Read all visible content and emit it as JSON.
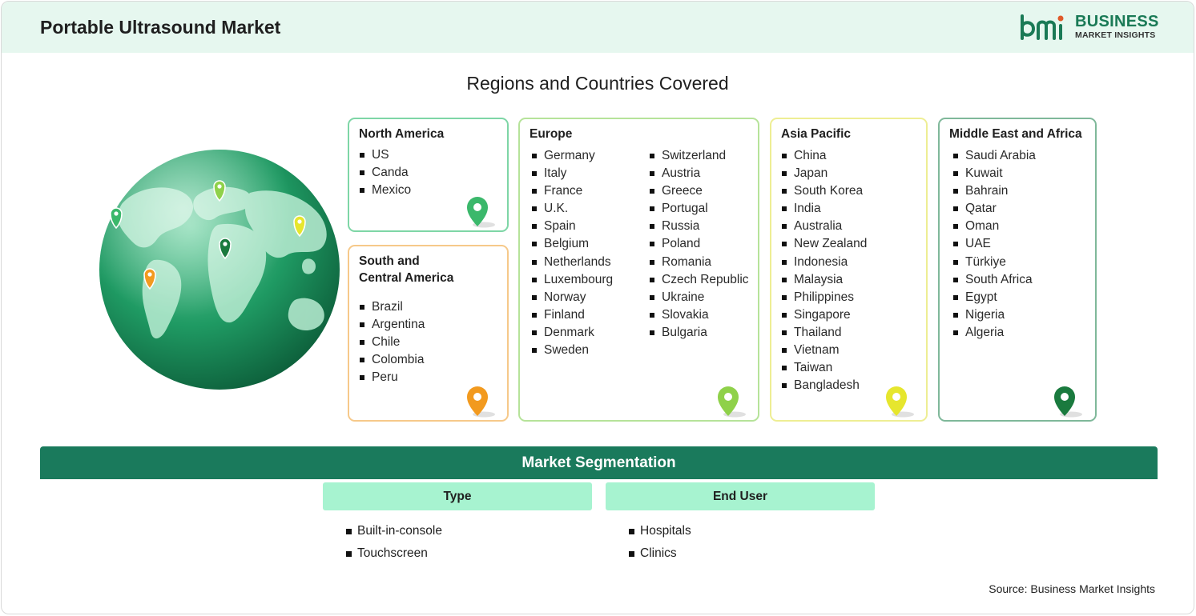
{
  "header": {
    "title": "Portable Ultrasound Market"
  },
  "logo": {
    "word1": "BUSINESS",
    "word2": "MARKET INSIGHTS",
    "brand_color": "#1a7a56"
  },
  "regions_title": "Regions and Countries Covered",
  "regions": {
    "north_america": {
      "title": "North America",
      "countries": [
        "US",
        "Canda",
        "Mexico"
      ],
      "pin_color": "#3bb86b",
      "border": "#7ed6a6"
    },
    "south_central_america": {
      "title_line1": "South and",
      "title_line2": "Central America",
      "countries": [
        "Brazil",
        "Argentina",
        "Chile",
        "Colombia",
        "Peru"
      ],
      "pin_color": "#f29a1f",
      "border": "#f6c98a"
    },
    "europe": {
      "title": "Europe",
      "col1": [
        "Germany",
        "Italy",
        "France",
        "U.K.",
        "Spain",
        "Belgium",
        "Netherlands",
        "Luxembourg",
        "Norway",
        "Finland",
        "Denmark",
        "Sweden"
      ],
      "col2": [
        "Switzerland",
        "Austria",
        "Greece",
        "Portugal",
        "Russia",
        "Poland",
        "Romania",
        "Czech Republic",
        "Ukraine",
        "Slovakia",
        "Bulgaria"
      ],
      "pin_color": "#8fd14a",
      "border": "#b6e39a"
    },
    "asia_pacific": {
      "title": "Asia Pacific",
      "countries": [
        "China",
        "Japan",
        "South Korea",
        "India",
        "Australia",
        "New Zealand",
        "Indonesia",
        "Malaysia",
        "Philippines",
        "Singapore",
        "Thailand",
        "Vietnam",
        "Taiwan",
        "Bangladesh"
      ],
      "pin_color": "#e6e62e",
      "border": "#eeee94"
    },
    "middle_east_africa": {
      "title": "Middle East and Africa",
      "countries": [
        "Saudi Arabia",
        "Kuwait",
        "Bahrain",
        "Qatar",
        "Oman",
        "UAE",
        "Türkiye",
        "South Africa",
        "Egypt",
        "Nigeria",
        "Algeria"
      ],
      "pin_color": "#1a7a3e",
      "border": "#7fb89a"
    }
  },
  "segmentation": {
    "title": "Market Segmentation",
    "type": {
      "label": "Type",
      "items": [
        "Built-in-console",
        "Touchscreen"
      ]
    },
    "end_user": {
      "label": "End User",
      "items": [
        "Hospitals",
        "Clinics"
      ]
    }
  },
  "source": "Source: Business Market Insights"
}
